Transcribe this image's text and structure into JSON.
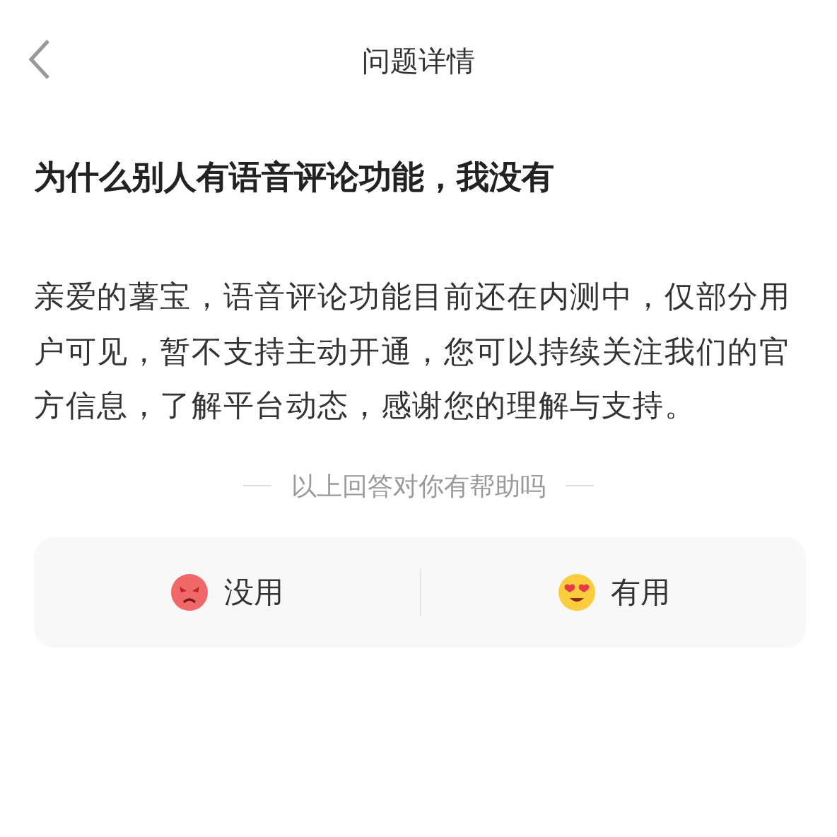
{
  "header": {
    "title": "问题详情"
  },
  "question": "为什么别人有语音评论功能，我没有",
  "answer": "亲爱的薯宝，语音评论功能目前还在内测中，仅部分用户可见，暂不支持主动开通，您可以持续关注我们的官方信息，了解平台动态，感谢您的理解与支持。",
  "feedback": {
    "prompt": "以上回答对你有帮助吗",
    "options": [
      {
        "kind": "angry",
        "label": "没用"
      },
      {
        "kind": "love",
        "label": "有用"
      }
    ]
  }
}
